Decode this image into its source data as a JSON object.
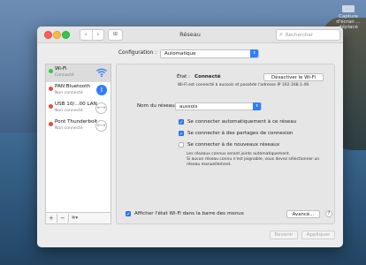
{
  "desktop": {
    "item_label": "Capture d'écran ...",
    "item_label_line2": "déplacé"
  },
  "window": {
    "title": "Réseau"
  },
  "toolbar": {
    "back": "‹",
    "forward": "›",
    "grid": "⊞"
  },
  "search": {
    "placeholder": "Rechercher"
  },
  "config": {
    "label": "Configuration :",
    "value": "Automatique"
  },
  "sidebar": {
    "items": [
      {
        "name": "Wi-Fi",
        "status": "Connecté",
        "dot_color": "#2ecc40",
        "icon": "wifi-icon"
      },
      {
        "name": "PAN Bluetooth",
        "status": "Non connecté",
        "dot_color": "#e84a3c",
        "icon": "bluetooth-icon"
      },
      {
        "name": "USB 10/...00 LAN",
        "status": "Non connecté",
        "dot_color": "#e84a3c",
        "icon": "ethernet-icon"
      },
      {
        "name": "Pont Thunderbolt",
        "status": "Non connecté",
        "dot_color": "#e84a3c",
        "icon": "ethernet-icon"
      }
    ],
    "add": "+",
    "remove": "−",
    "actions": "✲▾"
  },
  "detail": {
    "state_label": "État :",
    "state_value": "Connecté",
    "disable_wifi_button": "Désactiver le Wi-Fi",
    "state_desc": "Wi-Fi est connecté à aussois et possède l'adresse IP 192.168.1.49.",
    "network_label": "Nom du réseau :",
    "network_value": "aussois",
    "options": [
      {
        "label": "Se connecter automatiquement à ce réseau",
        "checked": true
      },
      {
        "label": "Se connecter à des partages de connexion",
        "checked": true
      },
      {
        "label": "Se connecter à de nouveaux réseaux",
        "checked": false
      }
    ],
    "new_networks_note_1": "Les réseaux connus seront joints automatiquement.",
    "new_networks_note_2": "Si aucun réseau connu n'est joignable, vous devez sélectionner un",
    "new_networks_note_3": "réseau manuellement.",
    "show_in_menubar": "Afficher l'état Wi-Fi dans la barre des menus",
    "advanced_button": "Avancé...",
    "help": "?"
  },
  "footer": {
    "revert": "Revenir",
    "apply": "Appliquer"
  }
}
